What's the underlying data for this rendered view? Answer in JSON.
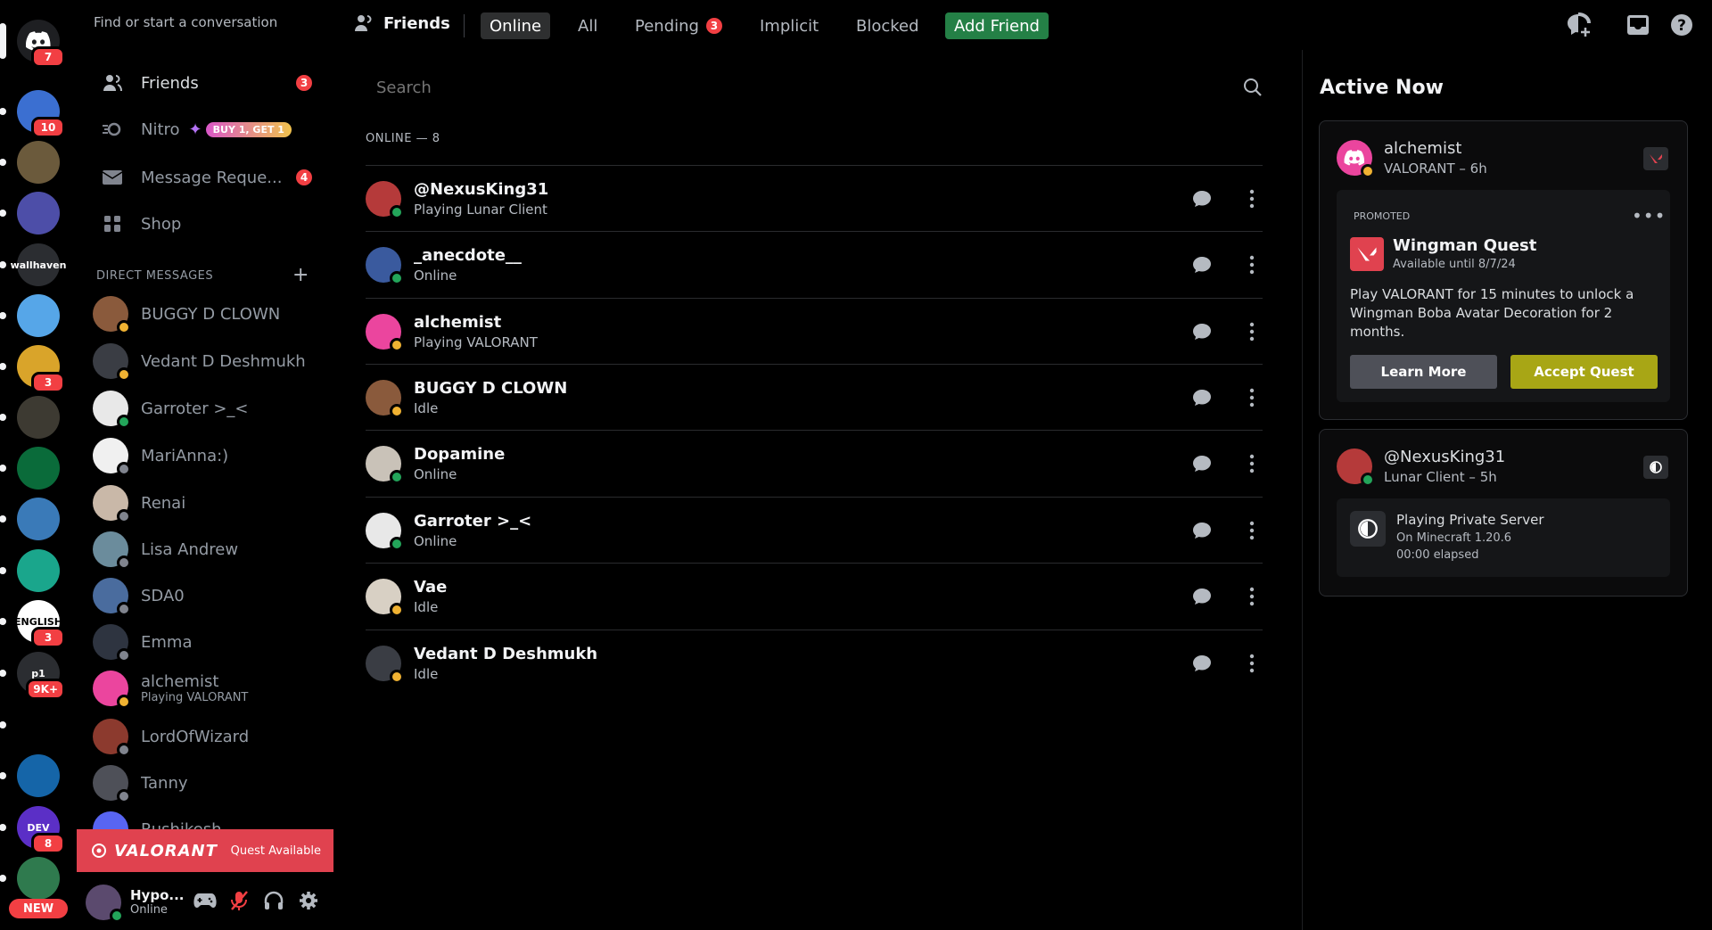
{
  "rail": {
    "home_badge": "7",
    "servers": [
      {
        "name": "server-1",
        "badge": "10",
        "color": "#3b6fd1"
      },
      {
        "name": "server-2",
        "badge": "",
        "color": "#6b5a3c"
      },
      {
        "name": "server-3",
        "badge": "",
        "color": "#4d4ea8"
      },
      {
        "name": "wallhaven",
        "label": "wallhaven",
        "badge": "",
        "color": "#2b2d31"
      },
      {
        "name": "server-5",
        "badge": "",
        "color": "#56a6e8"
      },
      {
        "name": "server-6",
        "badge": "3",
        "color": "#d9a42a"
      },
      {
        "name": "server-7",
        "badge": "",
        "color": "#3d3a32"
      },
      {
        "name": "server-8",
        "badge": "",
        "color": "#0a6b3a"
      },
      {
        "name": "server-9",
        "badge": "",
        "color": "#3a7ab8"
      },
      {
        "name": "server-10",
        "badge": "",
        "color": "#1aa68c"
      },
      {
        "name": "english",
        "label": "ENGLISH",
        "badge": "3",
        "color": "#ffffff"
      },
      {
        "name": "p1",
        "label": "p1",
        "badge": "9K+",
        "color": "#2b2d31"
      },
      {
        "name": "server-13",
        "badge": "",
        "color": "#000000"
      },
      {
        "name": "server-14",
        "badge": "",
        "color": "#1565a8"
      },
      {
        "name": "dev",
        "label": "DEV",
        "badge": "8",
        "color": "#5b2fc6"
      },
      {
        "name": "server-16",
        "badge": "",
        "color": "#2f7a4e"
      }
    ],
    "new_label": "NEW"
  },
  "sidebar": {
    "search_label": "Find or start a conversation",
    "nav": [
      {
        "label": "Friends",
        "badge": "3"
      },
      {
        "label": "Nitro",
        "promo": "BUY 1, GET 1"
      },
      {
        "label": "Message Reque...",
        "badge": "4"
      },
      {
        "label": "Shop"
      }
    ],
    "dm_header": "DIRECT MESSAGES",
    "dms": [
      {
        "name": "BUGGY D CLOWN",
        "status": "idle",
        "color": "#8a5a3c"
      },
      {
        "name": "Vedant D Deshmukh",
        "status": "idle",
        "color": "#3a3d44"
      },
      {
        "name": "Garroter >_<",
        "status": "online",
        "color": "#e8e8e8"
      },
      {
        "name": "MariAnna:)",
        "status": "offline",
        "color": "#f0f0f0"
      },
      {
        "name": "Renai",
        "status": "offline",
        "color": "#c9b8a8"
      },
      {
        "name": "Lisa Andrew",
        "status": "offline",
        "color": "#6b8c9c"
      },
      {
        "name": "SDA0",
        "status": "offline",
        "color": "#4a6c9e"
      },
      {
        "name": "Emma",
        "status": "offline",
        "color": "#2e3440"
      },
      {
        "name": "alchemist",
        "sub": "Playing VALORANT",
        "status": "idle",
        "color": "#eb459e"
      },
      {
        "name": "LordOfWizard",
        "status": "offline",
        "color": "#8c3a2e"
      },
      {
        "name": "Tanny",
        "status": "offline",
        "color": "#4e5058"
      },
      {
        "name": "Rushikesh",
        "status": "offline",
        "color": "#5865f2"
      }
    ],
    "quest_banner": {
      "game": "VALORANT",
      "label": "Quest Available"
    },
    "user": {
      "name": "Hypo...",
      "status": "Online"
    }
  },
  "topbar": {
    "title": "Friends",
    "tabs": [
      "Online",
      "All",
      "Pending",
      "Implicit",
      "Blocked"
    ],
    "pending_badge": "3",
    "add_friend": "Add Friend"
  },
  "main": {
    "search_placeholder": "Search",
    "online_count": "ONLINE — 8",
    "friends": [
      {
        "name": "@NexusKing31",
        "sub": "Playing Lunar Client",
        "status": "online",
        "color": "#b53a3a"
      },
      {
        "name": "_anecdote__",
        "sub": "Online",
        "status": "online",
        "color": "#3a5a9e"
      },
      {
        "name": "alchemist",
        "sub": "Playing VALORANT",
        "status": "idle",
        "color": "#eb459e"
      },
      {
        "name": "BUGGY D CLOWN",
        "sub": "Idle",
        "status": "idle",
        "color": "#8a5a3c"
      },
      {
        "name": "Dopamine",
        "sub": "Online",
        "status": "online",
        "color": "#c9c2b8"
      },
      {
        "name": "Garroter >_<",
        "sub": "Online",
        "status": "online",
        "color": "#e8e8e8"
      },
      {
        "name": "Vae",
        "sub": "Idle",
        "status": "idle",
        "color": "#d8d0c4"
      },
      {
        "name": "Vedant D Deshmukh",
        "sub": "Idle",
        "status": "idle",
        "color": "#3a3d44"
      }
    ]
  },
  "active_now": {
    "title": "Active Now",
    "card1": {
      "name": "alchemist",
      "activity": "VALORANT – 6h",
      "promoted": "PROMOTED",
      "quest_title": "Wingman Quest",
      "quest_until": "Available until 8/7/24",
      "quest_desc": "Play VALORANT for 15 minutes to unlock a Wingman Boba Avatar Decoration for 2 months.",
      "learn_more": "Learn More",
      "accept": "Accept Quest"
    },
    "card2": {
      "name": "@NexusKing31",
      "activity": "Lunar Client – 5h",
      "playing": "Playing Private Server",
      "detail": "On Minecraft 1.20.6",
      "elapsed": "00:00 elapsed"
    }
  },
  "colors": {
    "accent_green": "#248046",
    "badge_red": "#f23f43",
    "quest_yellow": "#a8a615",
    "valorant_red": "#e0424f"
  }
}
